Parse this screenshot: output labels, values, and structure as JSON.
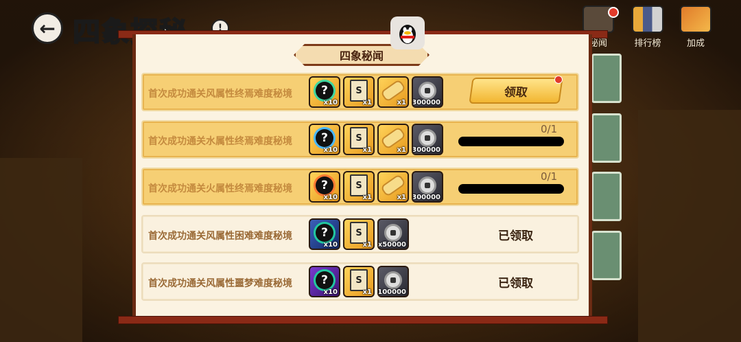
{
  "header": {
    "title": "四象探秘",
    "back_icon": "back-arrow-icon",
    "info_icon": "info-icon"
  },
  "top_right": [
    {
      "label": "秘闻",
      "icon": "shop-icon",
      "badge": true
    },
    {
      "label": "排行榜",
      "icon": "leaderboard-icon",
      "badge": false
    },
    {
      "label": "加成",
      "icon": "boost-icon",
      "badge": false
    }
  ],
  "overlay": {
    "icon": "qq-penguin-icon"
  },
  "panel": {
    "title": "四象秘闻",
    "rows": [
      {
        "label": "首次成功通关风属性终焉难度秘境",
        "state": "claimable",
        "action": "领取",
        "rewards": [
          {
            "icon": "mystery-orb-icon",
            "qty": "x10",
            "bg": "gold",
            "ring": "green"
          },
          {
            "icon": "scroll-paper-icon",
            "qty": "x1",
            "bg": "gold"
          },
          {
            "icon": "golden-scroll-icon",
            "qty": "x1",
            "bg": "gold"
          },
          {
            "icon": "coin-icon",
            "qty": "x300000",
            "bg": "dark"
          }
        ]
      },
      {
        "label": "首次成功通关水属性终焉难度秘境",
        "state": "progress",
        "progress": "0/1",
        "progress_value": 0,
        "rewards": [
          {
            "icon": "mystery-orb-icon",
            "qty": "x10",
            "bg": "gold",
            "ring": "blue"
          },
          {
            "icon": "scroll-paper-icon",
            "qty": "x1",
            "bg": "gold"
          },
          {
            "icon": "golden-scroll-icon",
            "qty": "x1",
            "bg": "gold"
          },
          {
            "icon": "coin-icon",
            "qty": "x300000",
            "bg": "dark"
          }
        ]
      },
      {
        "label": "首次成功通关火属性终焉难度秘境",
        "state": "progress",
        "progress": "0/1",
        "progress_value": 0,
        "rewards": [
          {
            "icon": "mystery-orb-icon",
            "qty": "x10",
            "bg": "gold",
            "ring": "red"
          },
          {
            "icon": "scroll-paper-icon",
            "qty": "x1",
            "bg": "gold"
          },
          {
            "icon": "golden-scroll-icon",
            "qty": "x1",
            "bg": "gold"
          },
          {
            "icon": "coin-icon",
            "qty": "x300000",
            "bg": "dark"
          }
        ]
      },
      {
        "label": "首次成功通关风属性困难难度秘境",
        "state": "claimed",
        "action": "已领取",
        "rewards": [
          {
            "icon": "mystery-orb-icon",
            "qty": "x10",
            "bg": "blue",
            "ring": "teal"
          },
          {
            "icon": "scroll-paper-icon",
            "qty": "x1",
            "bg": "gold"
          },
          {
            "icon": "coin-icon",
            "qty": "x50000",
            "bg": "dark"
          }
        ]
      },
      {
        "label": "首次成功通关风属性噩梦难度秘境",
        "state": "claimed",
        "action": "已领取",
        "rewards": [
          {
            "icon": "mystery-orb-icon",
            "qty": "x10",
            "bg": "purple",
            "ring": "teal"
          },
          {
            "icon": "scroll-paper-icon",
            "qty": "x1",
            "bg": "gold"
          },
          {
            "icon": "coin-icon",
            "qty": "x100000",
            "bg": "dark"
          }
        ]
      }
    ]
  }
}
